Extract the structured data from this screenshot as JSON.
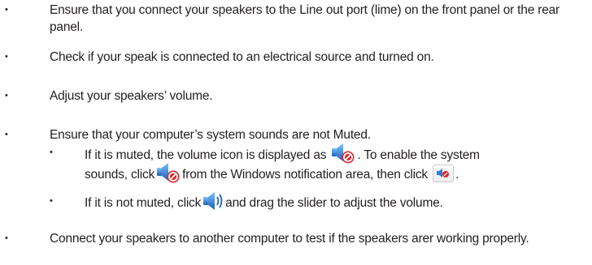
{
  "items": [
    {
      "text": "Ensure that you connect your speakers to the Line out port (lime) on the front panel or the rear panel."
    },
    {
      "text": "Check if your speak is connected to an electrical source and turned on."
    },
    {
      "text": "Adjust your speakers’ volume."
    },
    {
      "text": "Ensure that your computer’s system sounds are not Muted."
    },
    {
      "text": "Connect your speakers to another computer to test if the speakers arer working properly."
    }
  ],
  "sub_items": {
    "muted": {
      "part1": "If it is muted, the volume icon is displayed as",
      "part2": ". To enable the system sounds, click",
      "part3": "from the Windows notification area, then click",
      "part4": "."
    },
    "not_muted": {
      "part1": "If it is not muted, click",
      "part2": "and drag the slider to adjust the volume."
    }
  },
  "icons": {
    "muted_speaker": "speaker-muted-icon",
    "volume_speaker": "speaker-volume-icon",
    "mute_button": "mute-toggle-button-icon"
  },
  "colors": {
    "text": "#231f20",
    "speaker_blue": "#2f7fd6",
    "mute_red": "#e0262b"
  }
}
